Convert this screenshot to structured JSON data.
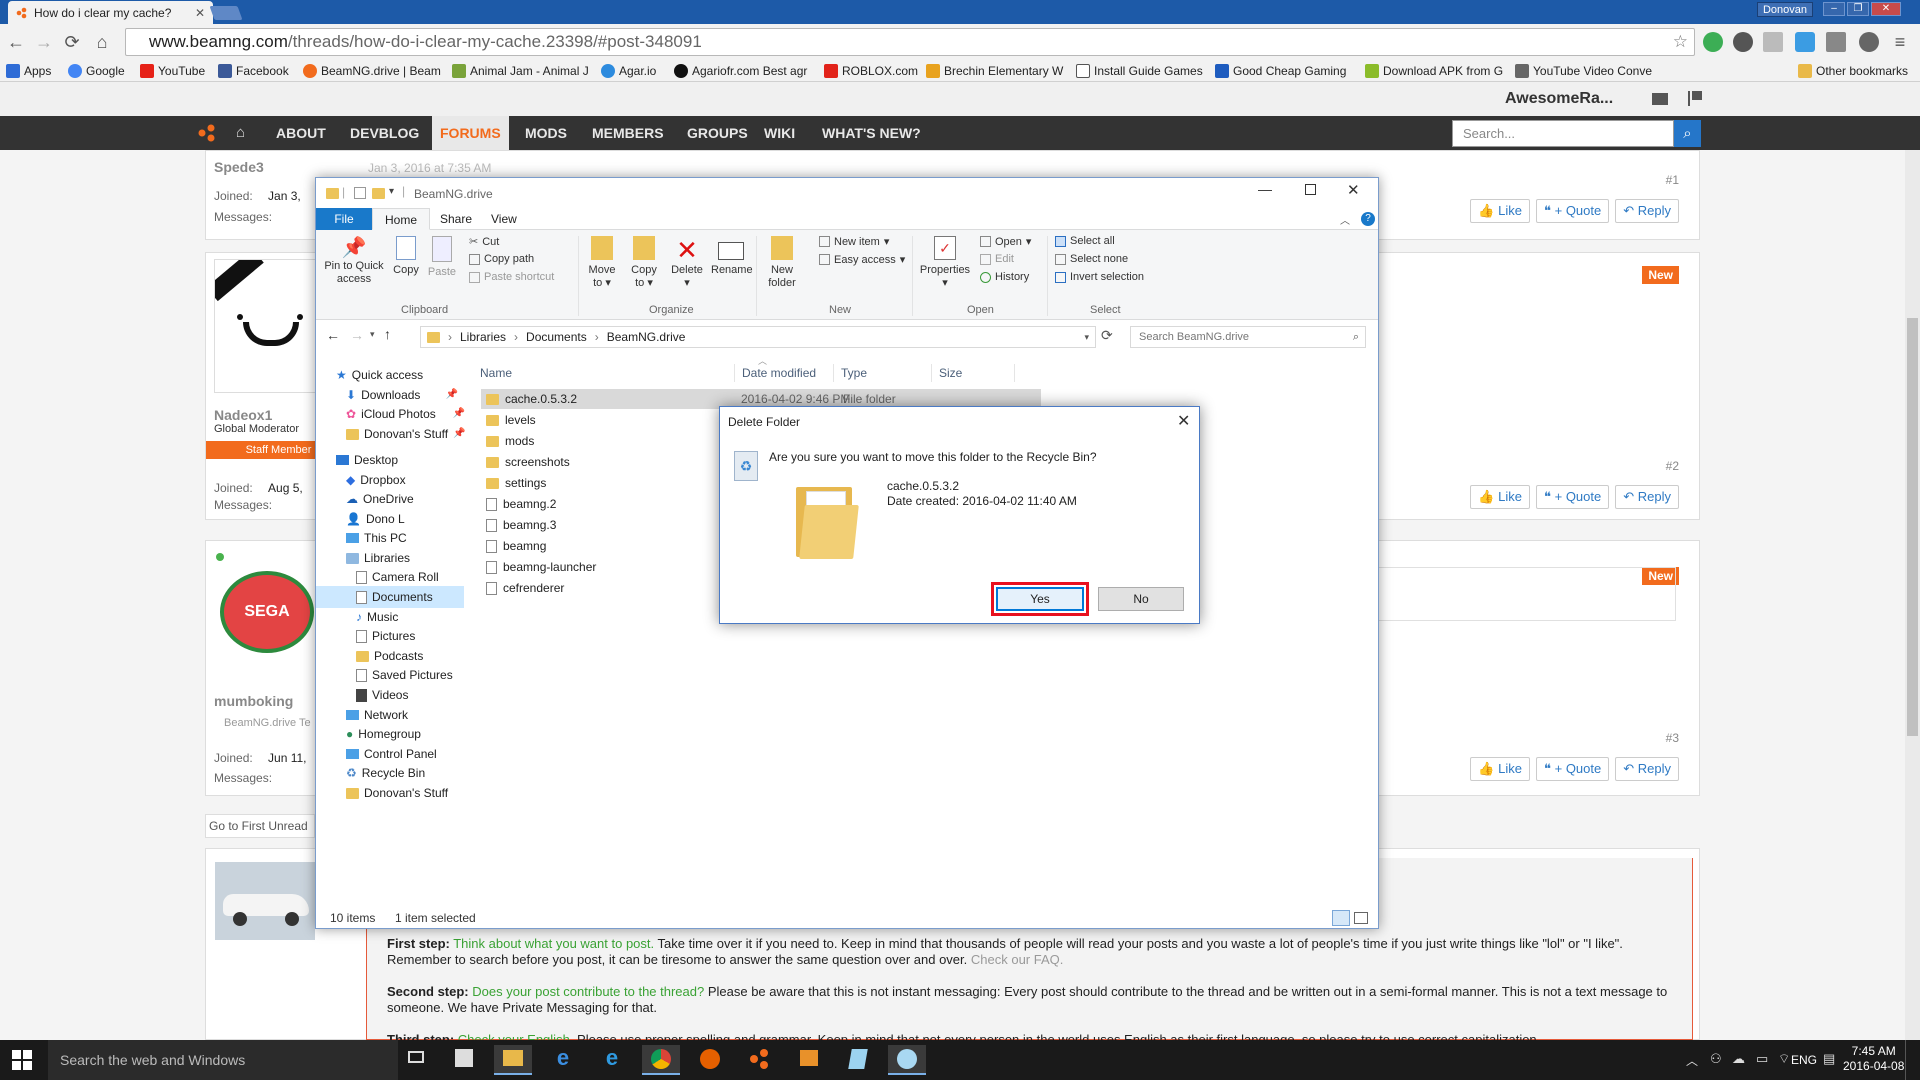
{
  "browser": {
    "tab_title": "How do i clear my cache?",
    "user_badge": "Donovan",
    "url_domain": "www.beamng.com",
    "url_path": "/threads/how-do-i-clear-my-cache.23398/#post-348091",
    "bookmarks": [
      "Apps",
      "Google",
      "YouTube",
      "Facebook",
      "BeamNG.drive | Beam",
      "Animal Jam - Animal J",
      "Agar.io",
      "Agariofr.com Best agr",
      "ROBLOX.com",
      "Brechin Elementary W",
      "Install Guide Games",
      "Good Cheap Gaming",
      "Download APK from G",
      "YouTube Video Conve"
    ],
    "other_bookmarks": "Other bookmarks"
  },
  "site": {
    "username": "AwesomeRa...",
    "nav": [
      "ABOUT",
      "DEVBLOG",
      "FORUMS",
      "MODS",
      "MEMBERS",
      "GROUPS",
      "WIKI",
      "WHAT'S NEW?"
    ],
    "search_placeholder": "Search...",
    "post_time_fragment": "Jan 3, 2016 at 7:35 AM",
    "posts": [
      {
        "user": "Spede3",
        "joined_label": "Joined:",
        "joined": "Jan 3,",
        "messages_label": "Messages:",
        "num": "#1"
      },
      {
        "user": "Nadeox1",
        "role": "Global Moderator",
        "badge": "Staff Member",
        "joined_label": "Joined:",
        "joined": "Aug 5,",
        "messages_label": "Messages:",
        "num": "#2",
        "new": "New"
      },
      {
        "user": "mumboking",
        "role": "BeamNG.drive Te",
        "joined_label": "Joined:",
        "joined": "Jun 11,",
        "messages_label": "Messages:",
        "num": "#3",
        "new": "New"
      }
    ],
    "like": "Like",
    "quote": "+ Quote",
    "reply": "Reply",
    "go_first_unread": "Go to First Unread",
    "rules": {
      "first_label": "First step:",
      "first_link": "Think about what you want to post.",
      "first_text": " Take time over it if you need to. Keep in mind that thousands of people will read your posts and you waste a lot of people's time if you just write things like \"lol\" or \"I like\". Remember to search before you post, it can be tiresome to answer the same question over and over. ",
      "first_faq": "Check our FAQ.",
      "second_label": "Second step:",
      "second_link": "Does your post contribute to the thread?",
      "second_text": " Please be aware that this is not instant messaging: Every post should contribute to the thread and be written out in a semi-formal manner. This is not a text message to someone. We have Private Messaging for that.",
      "third_label": "Third step:",
      "third_link": "Check your English.",
      "third_text": " Please use proper spelling and grammar. Keep in mind that not every person in the world uses English as their first language, so please try to use correct capitalization."
    }
  },
  "explorer": {
    "title": "BeamNG.drive",
    "tabs": [
      "File",
      "Home",
      "Share",
      "View"
    ],
    "ribbon": {
      "pin": "Pin to Quick access",
      "copy": "Copy",
      "paste": "Paste",
      "cut": "Cut",
      "copy_path": "Copy path",
      "paste_shortcut": "Paste shortcut",
      "move_to": "Move to",
      "copy_to": "Copy to",
      "delete": "Delete",
      "rename": "Rename",
      "new_folder": "New folder",
      "new_item": "New item",
      "easy_access": "Easy access",
      "properties": "Properties",
      "open": "Open",
      "edit": "Edit",
      "history": "History",
      "select_all": "Select all",
      "select_none": "Select none",
      "invert_selection": "Invert selection",
      "groups": [
        "Clipboard",
        "Organize",
        "New",
        "Open",
        "Select"
      ]
    },
    "breadcrumb": [
      "Libraries",
      "Documents",
      "BeamNG.drive"
    ],
    "search_placeholder": "Search BeamNG.drive",
    "nav": [
      "Quick access",
      "Downloads",
      "iCloud Photos",
      "Donovan's Stuff",
      "Desktop",
      "Dropbox",
      "OneDrive",
      "Dono L",
      "This PC",
      "Libraries",
      "Camera Roll",
      "Documents",
      "Music",
      "Pictures",
      "Podcasts",
      "Saved Pictures",
      "Videos",
      "Network",
      "Homegroup",
      "Control Panel",
      "Recycle Bin",
      "Donovan's Stuff"
    ],
    "columns": [
      "Name",
      "Date modified",
      "Type",
      "Size"
    ],
    "files": [
      {
        "name": "cache.0.5.3.2",
        "date": "2016-04-02 9:46 PM",
        "type": "File folder"
      },
      {
        "name": "levels"
      },
      {
        "name": "mods"
      },
      {
        "name": "screenshots"
      },
      {
        "name": "settings"
      },
      {
        "name": "beamng.2"
      },
      {
        "name": "beamng.3"
      },
      {
        "name": "beamng"
      },
      {
        "name": "beamng-launcher"
      },
      {
        "name": "cefrenderer"
      }
    ],
    "status_items": "10 items",
    "status_selected": "1 item selected"
  },
  "dialog": {
    "title": "Delete Folder",
    "question": "Are you sure you want to move this folder to the Recycle Bin?",
    "name": "cache.0.5.3.2",
    "date_created": "Date created: 2016-04-02 11:40 AM",
    "yes": "Yes",
    "no": "No"
  },
  "taskbar": {
    "search": "Search the web and Windows",
    "lang": "ENG",
    "time": "7:45 AM",
    "date": "2016-04-08"
  },
  "colors": {
    "accent": "#1979ca",
    "brand": "#f26b1d",
    "highlight": "#e8111f"
  }
}
